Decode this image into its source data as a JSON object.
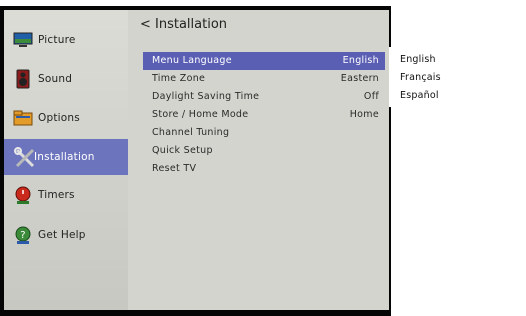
{
  "sidebar": {
    "items": [
      {
        "label": "Picture",
        "icon": "monitor-icon"
      },
      {
        "label": "Sound",
        "icon": "speaker-icon"
      },
      {
        "label": "Options",
        "icon": "folder-icon"
      },
      {
        "label": "Installation",
        "icon": "tools-icon"
      },
      {
        "label": "Timers",
        "icon": "timer-icon"
      },
      {
        "label": "Get Help",
        "icon": "help-icon"
      }
    ]
  },
  "main": {
    "title": "< Installation",
    "rows": [
      {
        "label": "Menu Language",
        "value": "English"
      },
      {
        "label": "Time Zone",
        "value": "Eastern"
      },
      {
        "label": "Daylight Saving Time",
        "value": "Off"
      },
      {
        "label": "Store / Home Mode",
        "value": "Home"
      },
      {
        "label": "Channel Tuning",
        "value": ""
      },
      {
        "label": "Quick Setup",
        "value": ""
      },
      {
        "label": "Reset TV",
        "value": ""
      }
    ]
  },
  "language_popup": {
    "options": [
      "English",
      "Français",
      "Español"
    ]
  },
  "colors": {
    "selected_row": "#5b5fb4",
    "active_sidebar": "#6c74bd",
    "panel_bg": "#d4d4ce",
    "frame": "#050505"
  }
}
